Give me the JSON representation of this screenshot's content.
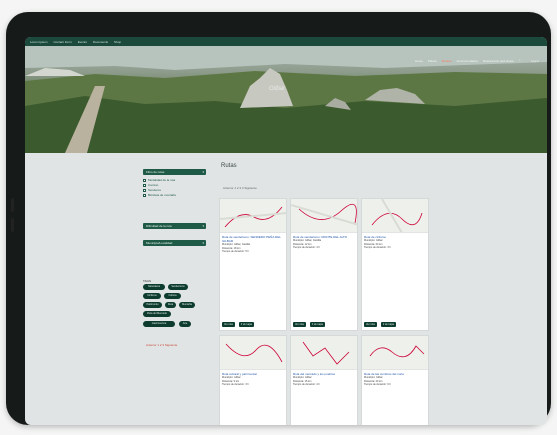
{
  "topbar": {
    "links": [
      "Lorem Ipsum",
      "Contact Form",
      "Events",
      "Documents",
      "Shop"
    ]
  },
  "nav": {
    "items": [
      "Home",
      "Places",
      "Routes",
      "Accommodation",
      "Restaurants and shops"
    ],
    "active_index": 2,
    "login_label": "Log in"
  },
  "logo_text": "Gilbar",
  "sidebar": {
    "section1_title": "Filtro de rutas",
    "section1_options": [
      "Modalidad de la ruta",
      "Camino",
      "Senderos",
      "Bicicleta de montaña"
    ],
    "section2_title": "Dificultad de la ruta",
    "section3_title": "Municipio/Localidad",
    "tags_title": "TAGS",
    "tags": [
      "Naturaleza",
      "Senderismo",
      "Ciclismo",
      "Cultura",
      "Patrimonio",
      "Ruta",
      "Montaña",
      "Ruta del Mercado",
      "Gastronomía",
      "Arte"
    ],
    "pager": "Anterior   1   2   3   Siguiente"
  },
  "main": {
    "title": "Rutas",
    "pager": "Anterior   1   2   3   4   Siguiente",
    "card_buttons": [
      "Ver ruta",
      "Ir al mapa"
    ],
    "cards": [
      {
        "title": "Ruta de senderismo: SENDERO PEÑA DEL GILBAR",
        "meta": [
          "Municipio: Gilbar, Castilla",
          "Distancia: 18 km",
          "Tiempo de duración: 5 h"
        ]
      },
      {
        "title": "Ruta de senderismo: MONTE DEL ALTO",
        "meta": [
          "Municipio: Gilbar, Castilla",
          "Distancia: 12 km",
          "Tiempo de duración: 4 h"
        ]
      },
      {
        "title": "Ruta de ciclismo",
        "meta": [
          "Municipio: Gilbar",
          "Distancia: 24 km",
          "Tiempo de duración: 3 h"
        ]
      },
      {
        "title": "Ruta cultural y patrimonial",
        "meta": [
          "Municipio: Gilbar",
          "Distancia: 9 km",
          "Tiempo de duración: 3 h"
        ]
      },
      {
        "title": "Ruta del mercado y los pueblos",
        "meta": [
          "Municipio: Gilbar",
          "Distancia: 15 km",
          "Tiempo de duración: 4 h"
        ]
      },
      {
        "title": "Ruta de las cumbres del norte",
        "meta": [
          "Municipio: Gilbar",
          "Distancia: 20 km",
          "Tiempo de duración: 6 h"
        ]
      }
    ]
  },
  "colors": {
    "primary": "#1e5a46",
    "dark": "#0d3b2e",
    "accent": "#ff7a5a"
  }
}
